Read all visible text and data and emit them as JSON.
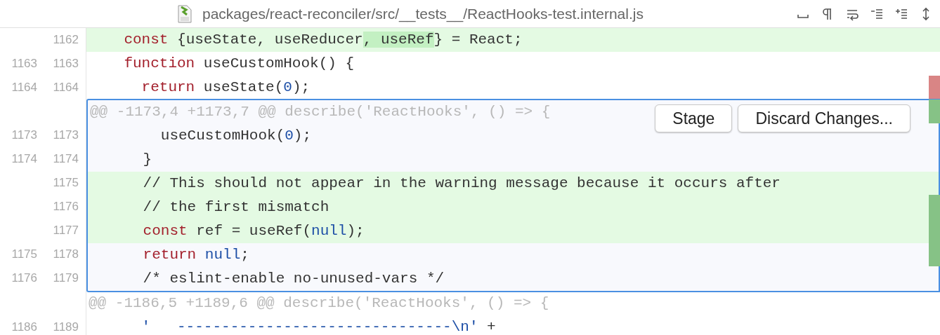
{
  "header": {
    "path": "packages/react-reconciler/src/__tests__/ReactHooks-test.internal.js"
  },
  "blocks": [
    {
      "selected": false,
      "lines": [
        {
          "kind": "added",
          "new": "1162",
          "tokens": [
            {
              "kind": "keyword",
              "text": "    const"
            },
            {
              "kind": "plain",
              "text": " {useState, useReducer"
            },
            {
              "kind": "plain",
              "text": ", useRef",
              "highlight": true
            },
            {
              "kind": "plain",
              "text": "} = React;"
            }
          ]
        },
        {
          "kind": "context",
          "old": "1163",
          "new": "1163",
          "tokens": [
            {
              "kind": "keyword",
              "text": "    function"
            },
            {
              "kind": "plain",
              "text": " useCustomHook() {"
            }
          ]
        },
        {
          "kind": "context",
          "old": "1164",
          "new": "1164",
          "color": "#d98585",
          "tokens": [
            {
              "kind": "keyword",
              "text": "      return"
            },
            {
              "kind": "plain",
              "text": " useState("
            },
            {
              "kind": "number",
              "text": "0"
            },
            {
              "kind": "plain",
              "text": ");"
            }
          ]
        }
      ]
    },
    {
      "selected": true,
      "actions": [
        {
          "label": "Stage"
        },
        {
          "label": "Discard Changes..."
        }
      ],
      "lines": [
        {
          "kind": "hunk",
          "color": "#86c286",
          "tokens": [
            {
              "kind": "hunk",
              "text": "@@ -1173,4 +1173,7 @@ describe('ReactHooks', () => {"
            }
          ]
        },
        {
          "kind": "context",
          "old": "1173",
          "new": "1173",
          "tokens": [
            {
              "kind": "plain",
              "text": "        useCustomHook("
            },
            {
              "kind": "number",
              "text": "0"
            },
            {
              "kind": "plain",
              "text": ");"
            }
          ]
        },
        {
          "kind": "context",
          "old": "1174",
          "new": "1174",
          "tokens": [
            {
              "kind": "plain",
              "text": "      }"
            }
          ]
        },
        {
          "kind": "added",
          "new": "1175",
          "tokens": [
            {
              "kind": "plain",
              "text": "      // This should not appear in the warning message because it occurs after"
            }
          ]
        },
        {
          "kind": "added",
          "new": "1176",
          "color": "#86c286",
          "tokens": [
            {
              "kind": "plain",
              "text": "      // the first mismatch"
            }
          ]
        },
        {
          "kind": "added",
          "new": "1177",
          "color": "#86c286",
          "tokens": [
            {
              "kind": "keyword",
              "text": "      const"
            },
            {
              "kind": "plain",
              "text": " ref = useRef("
            },
            {
              "kind": "number",
              "text": "null"
            },
            {
              "kind": "plain",
              "text": ");"
            }
          ]
        },
        {
          "kind": "context",
          "old": "1175",
          "new": "1178",
          "color": "#86c286",
          "tokens": [
            {
              "kind": "keyword",
              "text": "      return"
            },
            {
              "kind": "number",
              "text": " null"
            },
            {
              "kind": "plain",
              "text": ";"
            }
          ]
        },
        {
          "kind": "context",
          "old": "1176",
          "new": "1179",
          "tokens": [
            {
              "kind": "plain",
              "text": "      /* eslint-enable no-unused-vars */"
            }
          ]
        }
      ]
    },
    {
      "selected": false,
      "lines": [
        {
          "kind": "hunk",
          "tokens": [
            {
              "kind": "hunk",
              "text": "@@ -1186,5 +1189,6 @@ describe('ReactHooks', () => {"
            }
          ]
        },
        {
          "kind": "context",
          "old": "1186",
          "new": "1189",
          "tokens": [
            {
              "kind": "string",
              "text": "      '   -------------------------------\\n'"
            },
            {
              "kind": "plain",
              "text": " +"
            }
          ]
        }
      ]
    }
  ]
}
